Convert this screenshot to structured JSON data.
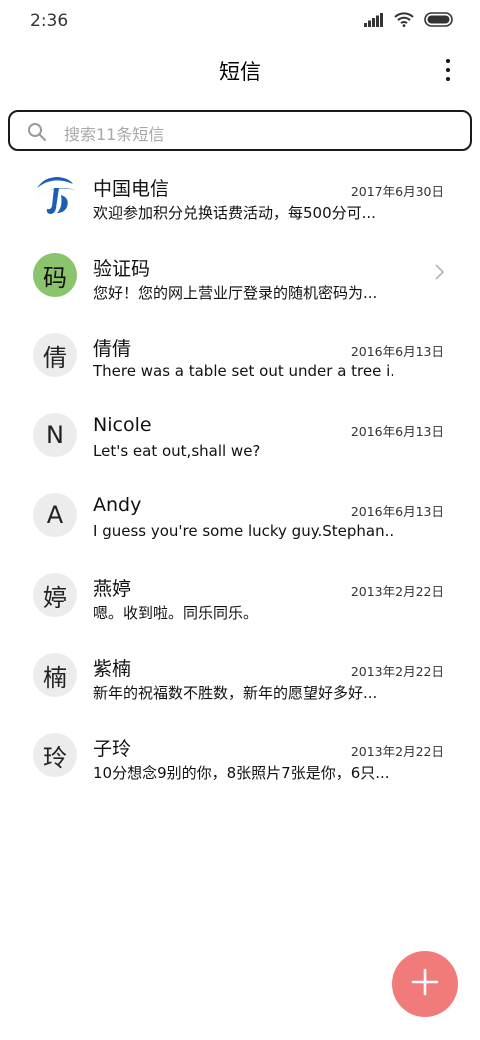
{
  "status_bar": {
    "time": "2:36"
  },
  "header": {
    "title": "短信"
  },
  "search": {
    "placeholder": "搜索11条短信"
  },
  "colors": {
    "fab": "#f17b7b",
    "verification_avatar": "#8bc46c",
    "avatar_default": "#ececec"
  },
  "conversations": [
    {
      "avatar": "",
      "avatar_icon": "china-telecom-logo-icon",
      "name": "中国电信",
      "date": "2017年6月30日",
      "preview": "欢迎参加积分兑换话费活动，每500分可..."
    },
    {
      "avatar": "码",
      "name": "验证码",
      "date": "",
      "preview": "您好！您的网上营业厅登录的随机密码为..."
    },
    {
      "avatar": "倩",
      "name": "倩倩",
      "date": "2016年6月13日",
      "preview": "There was a table set out under a tree i..."
    },
    {
      "avatar": "N",
      "name": "Nicole",
      "date": "2016年6月13日",
      "preview": "Let's eat out,shall we?"
    },
    {
      "avatar": "A",
      "name": "Andy",
      "date": "2016年6月13日",
      "preview": "I guess you're some lucky guy.Stephan..."
    },
    {
      "avatar": "婷",
      "name": "燕婷",
      "date": "2013年2月22日",
      "preview": "嗯。收到啦。同乐同乐。"
    },
    {
      "avatar": "楠",
      "name": "紫楠",
      "date": "2013年2月22日",
      "preview": "新年的祝福数不胜数，新年的愿望好多好..."
    },
    {
      "avatar": "玲",
      "name": "子玲",
      "date": "2013年2月22日",
      "preview": "10分想念9别的你，8张照片7张是你，6只..."
    }
  ]
}
